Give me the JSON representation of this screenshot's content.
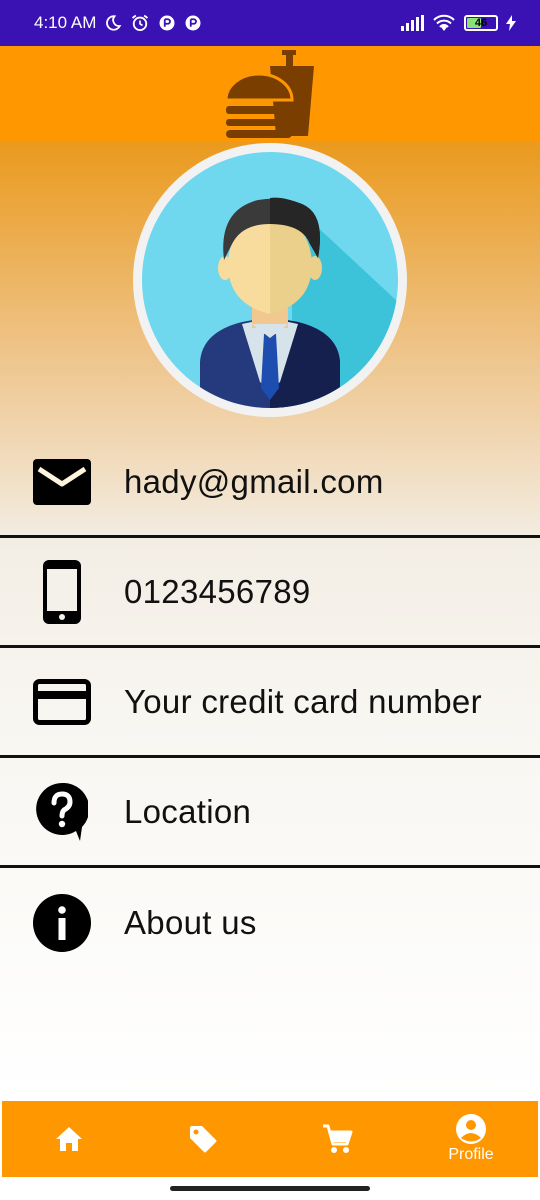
{
  "status_bar": {
    "time": "4:10 AM",
    "battery": "46",
    "icons": [
      "moon-icon",
      "alarm-icon",
      "app-notification-icon",
      "app-notification-icon",
      "signal-icon",
      "wifi-icon",
      "battery-icon",
      "charging-icon"
    ]
  },
  "header": {
    "logo": "burger-drink-logo",
    "background": "#ff9800"
  },
  "profile": {
    "avatar": "businessman-avatar",
    "items": [
      {
        "icon": "mail-icon",
        "label": "hady@gmail.com"
      },
      {
        "icon": "phone-icon",
        "label": "0123456789"
      },
      {
        "icon": "credit-card-icon",
        "label": "Your credit card number"
      },
      {
        "icon": "help-icon",
        "label": "Location"
      },
      {
        "icon": "info-icon",
        "label": "About us"
      }
    ]
  },
  "bottom_nav": {
    "items": [
      {
        "icon": "home-icon",
        "label": ""
      },
      {
        "icon": "tag-icon",
        "label": ""
      },
      {
        "icon": "cart-icon",
        "label": ""
      },
      {
        "icon": "account-icon",
        "label": "Profile",
        "active": true
      }
    ],
    "background": "#ff9800"
  }
}
